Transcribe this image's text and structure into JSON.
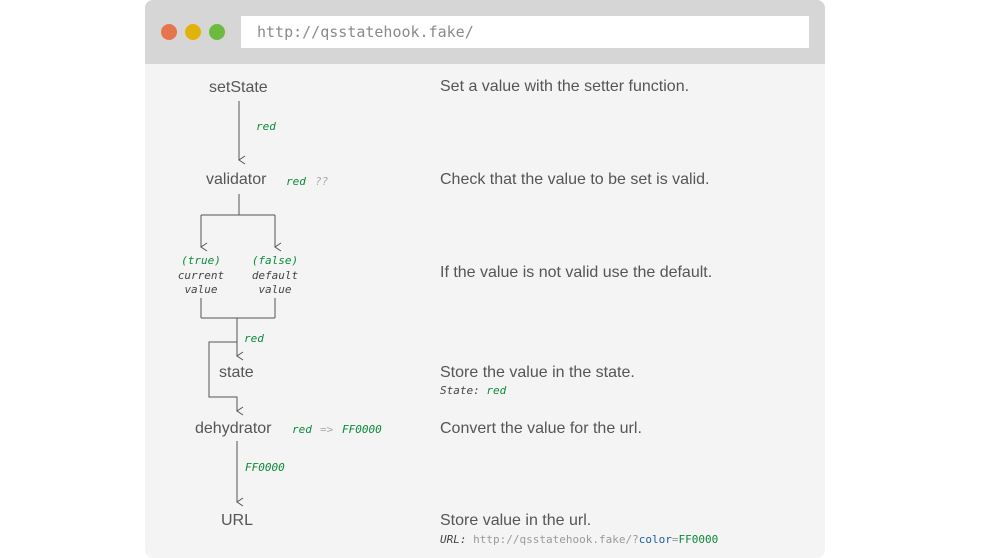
{
  "window": {
    "url": "http://qsstatehook.fake/",
    "dots": {
      "close": "#e8744f",
      "minimize": "#e2b20c",
      "maximize": "#6cbb3f"
    }
  },
  "colors": {
    "accent_green": "#0a8a3a",
    "param_blue": "#1a5fa0"
  },
  "diagram": {
    "setstate": "setState",
    "setstate_value": "red",
    "validator": "validator",
    "validator_value": "red",
    "validator_unknown": "??",
    "branch_true": "(true)",
    "branch_true_line1": "current",
    "branch_true_line2": "value",
    "branch_false": "(false)",
    "branch_false_line1": "default",
    "branch_false_line2": "value",
    "merged_value": "red",
    "state": "state",
    "dehydrator": "dehydrator",
    "dehydrator_in": "red",
    "dehydrator_arrow": "=>",
    "dehydrator_out": "FF0000",
    "url_value": "FF0000",
    "url": "URL"
  },
  "descriptions": {
    "setstate": "Set a value with the setter function.",
    "validator": "Check that the value to be set is valid.",
    "default": "If the value is not valid use the default.",
    "state": "Store the value in the state.",
    "state_code_label": "State:",
    "state_code_value": "red",
    "dehydrator": "Convert the value for the url.",
    "url": "Store value in the url.",
    "url_code_label": "URL:",
    "url_code_base": "http://qsstatehook.fake/?",
    "url_code_param": "color",
    "url_code_eq": "=",
    "url_code_value": "FF0000"
  }
}
